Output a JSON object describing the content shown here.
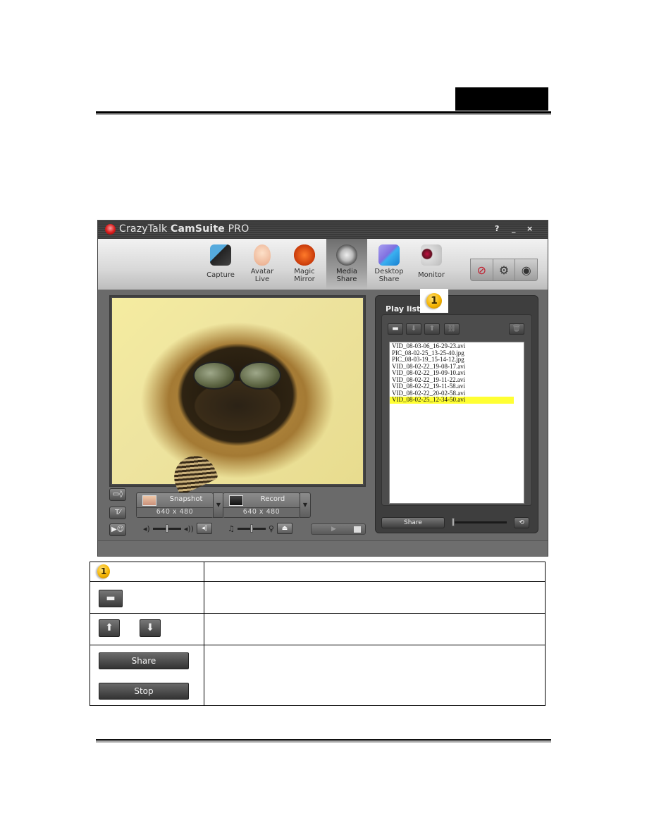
{
  "page": {
    "language_tab": "",
    "header_rule": true
  },
  "app": {
    "title_prefix": "CrazyTalk ",
    "title_bold": "CamSuite",
    "title_suffix": " PRO",
    "window_buttons": {
      "help": "?",
      "minimize": "_",
      "close": "×"
    },
    "tools": [
      {
        "id": "capture",
        "label_line1": "Capture",
        "label_line2": "",
        "icon": "camera-icon"
      },
      {
        "id": "avatar-live",
        "label_line1": "Avatar",
        "label_line2": "Live",
        "icon": "avatar-icon"
      },
      {
        "id": "magic-mirror",
        "label_line1": "Magic",
        "label_line2": "Mirror",
        "icon": "mask-icon"
      },
      {
        "id": "media-share",
        "label_line1": "Media",
        "label_line2": "Share",
        "icon": "film-reel-icon",
        "active": true
      },
      {
        "id": "desktop-share",
        "label_line1": "Desktop",
        "label_line2": "Share",
        "icon": "monitors-icon"
      },
      {
        "id": "monitor",
        "label_line1": "Monitor",
        "label_line2": "",
        "icon": "security-camera-icon"
      }
    ],
    "right_tools": [
      {
        "name": "no-broadcast-icon",
        "glyph": "⊘"
      },
      {
        "name": "settings-gear-icon",
        "glyph": "⚙"
      },
      {
        "name": "webcam-lock-icon",
        "glyph": "◉"
      }
    ],
    "capture_controls": {
      "snapshot": {
        "label": "Snapshot",
        "resolution": "640 x 480",
        "dropdown": "▼"
      },
      "record": {
        "label": "Record",
        "resolution": "640 x 480",
        "dropdown": "▼"
      },
      "side_buttons": [
        "▭◊",
        "T⁄",
        "▶☺"
      ],
      "volume_left_icon": "◂)",
      "volume_right_icon": "◂))",
      "speaker_button": "◂|",
      "music_icon": "♫",
      "mic_icon": "♀",
      "mixer_button": "⏏"
    },
    "playlist": {
      "title": "Play list",
      "callout_number": "1",
      "tool_buttons": [
        {
          "name": "open-folder-button",
          "glyph": "▬",
          "enabled": true
        },
        {
          "name": "move-down-button",
          "glyph": "⬇",
          "enabled": false
        },
        {
          "name": "move-up-button",
          "glyph": "⬆",
          "enabled": false
        },
        {
          "name": "link-button",
          "glyph": "⛓",
          "enabled": false
        },
        {
          "name": "delete-button",
          "glyph": "🗑",
          "enabled": false
        }
      ],
      "items": [
        "VID_08-03-06_16-29-23.avi",
        "PIC_08-02-25_13-25-40.jpg",
        "PIC_08-03-19_15-14-12.jpg",
        "VID_08-02-22_19-08-17.avi",
        "VID_08-02-22_19-09-10.avi",
        "VID_08-02-22_19-11-22.avi",
        "VID_08-02-22_19-11-58.avi",
        "VID_08-02-22_20-02-58.avi",
        "VID_08-02-25_12-34-50.avi"
      ],
      "selected_index": 8,
      "share_label": "Share",
      "share_icon": "⟲"
    }
  },
  "legend": {
    "row1": {
      "badge": "1",
      "description": ""
    },
    "row2": {
      "icon": "▬",
      "description": ""
    },
    "row3": {
      "up_icon": "⬆",
      "down_icon": "⬇",
      "description": ""
    },
    "row4": {
      "share_label": "Share",
      "stop_label": "Stop",
      "description": ""
    }
  },
  "colors": {
    "selection_highlight": "#ffff33",
    "window_chrome": "#3a3a3a",
    "badge": "#f5b400"
  }
}
